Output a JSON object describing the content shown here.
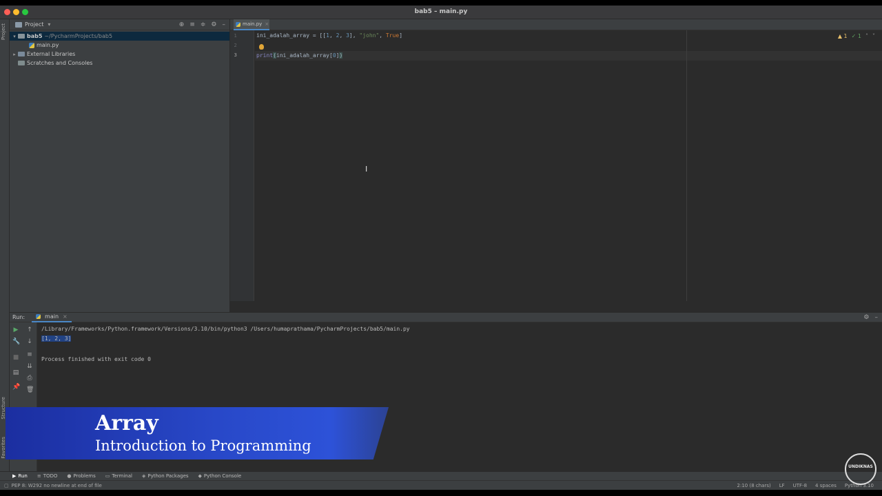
{
  "window": {
    "title": "bab5 – main.py"
  },
  "left_strip": {
    "project_tab": "Project",
    "structure_tab": "Structure",
    "favorites_tab": "Favorites"
  },
  "project": {
    "header": "Project",
    "tree": [
      {
        "label": "bab5",
        "path": "~/PycharmProjects/bab5"
      },
      {
        "label": "main.py"
      },
      {
        "label": "External Libraries"
      },
      {
        "label": "Scratches and Consoles"
      }
    ]
  },
  "editor": {
    "tab_label": "main.py",
    "line_numbers": [
      "1",
      "2",
      "3"
    ],
    "lines": [
      {
        "var": "ini_adalah_array",
        "eq": " = [[",
        "n1": "1",
        "c1": ", ",
        "n2": "2",
        "c2": ", ",
        "n3": "3",
        "c3": "], ",
        "str": "\"john\"",
        "c4": ", ",
        "kw": "True",
        "end": "]"
      },
      {
        "fn": "print",
        "open": "(",
        "var": "ini_adalah_array[",
        "idx": "0",
        "close_br": "]",
        "close": ")"
      }
    ],
    "inspections": {
      "warnings": "▲ 1",
      "ok": "✓ 1"
    }
  },
  "run": {
    "label": "Run:",
    "config": "main",
    "console": {
      "command": "/Library/Frameworks/Python.framework/Versions/3.10/bin/python3 /Users/humaprathama/PycharmProjects/bab5/main.py",
      "output": "[1, 2, 3]",
      "exit": "Process finished with exit code 0"
    }
  },
  "banner": {
    "title": "Array",
    "subtitle": "Introduction to Programming"
  },
  "logo": {
    "text": "UNDIKNAS"
  },
  "toolwindows": [
    "Run",
    "TODO",
    "Problems",
    "Terminal",
    "Python Packages",
    "Python Console"
  ],
  "status": {
    "message": "PEP 8: W292 no newline at end of file",
    "position": "2:10 (8 chars)",
    "line_sep": "LF",
    "encoding": "UTF-8",
    "indent": "4 spaces",
    "interpreter": "Python 3.10"
  }
}
